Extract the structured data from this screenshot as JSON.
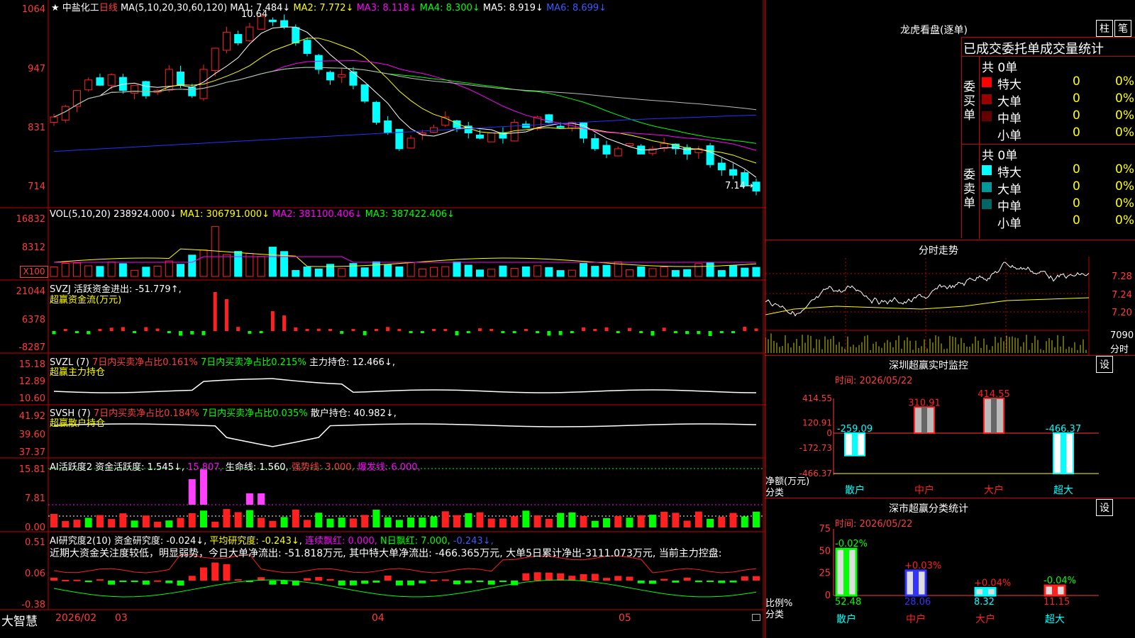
{
  "colors": {
    "up": "#ff2020",
    "down": "#00ffff",
    "grid": "#c00000",
    "axis": "#ff3b3b",
    "green": "#00ff00",
    "magenta": "#ff00ff",
    "yellow": "#ffff00",
    "blue": "#0000ff"
  },
  "header": {
    "star": "★",
    "stock": "中盐化工",
    "period": "日线",
    "ma_title": "MA(5,10,20,30,60,120)",
    "ma1": "MA1: 7.484↓",
    "ma2": "MA2: 7.772↓",
    "ma3": "MA3: 8.118↓",
    "ma4": "MA4: 8.300↓",
    "ma5": "MA5: 8.919↓",
    "ma6": "MA6: 8.699↓",
    "high_mark": "10.64",
    "low_mark": "7.14→"
  },
  "main_axis": [
    "1064",
    "947",
    "831",
    "714"
  ],
  "vol": {
    "title": "VOL(5,10,20)",
    "value": "238924.000↓",
    "ma1": "MA1: 306791.000↓",
    "ma2": "MA2: 381100.406↓",
    "ma3": "MA3: 387422.406↓",
    "axis": [
      "16832",
      "8312"
    ],
    "unit": "X100"
  },
  "svzj": {
    "title": "SVZJ  活跃资金进出: -51.779↑,",
    "sub": "超赢资金流(万元)",
    "axis": [
      "21044",
      "6378",
      "-8287"
    ]
  },
  "svzl": {
    "t1": "SVZL (7)",
    "t2": "7日内买卖净占比0.161%",
    "t3": "7日内买卖净占比0.215%",
    "t4": "主力持仓: 12.466↓,",
    "sub": "超赢主力持仓",
    "axis": [
      "15.18",
      "12.89",
      "10.60"
    ]
  },
  "svsh": {
    "t1": "SVSH (7)",
    "t2": "7日内买卖净占比0.184%",
    "t3": "7日内买卖净占比0.035%",
    "t4": "散户持仓: 40.982↓,",
    "sub": "超赢散户持仓",
    "axis": [
      "41.92",
      "39.60",
      "37.37"
    ]
  },
  "ai1": {
    "t1": "AI活跃度2",
    "t2": "资金活跃度: 1.545↓,",
    "t3": "15.807,",
    "t4": "生命线: 1.560,",
    "t5": "强势线: 3.000,",
    "t6": "爆发线: 6.000,",
    "axis": [
      "15.81",
      "7.81",
      "0.00"
    ]
  },
  "ai2": {
    "t1": "AI研究度2(10)",
    "t2": "资金研究度: -0.024↓,",
    "t3": "平均研究度: -0.243↓,",
    "t4": "连续飘红: 0.000,",
    "t5": "N日飘红: 7.000,",
    "t6": "-0.243↓,",
    "note": "近期大资金关注度较低，明显弱势，今日大单净流出: -51.818万元, 其中特大单净流出: -466.365万元, 大单5日累计净出-3111.073万元, 当前主力控盘:",
    "axis": [
      "0.51",
      "0.06",
      "-0.38"
    ]
  },
  "footer": {
    "brand": "大智慧",
    "dates": [
      "2026/02",
      "03",
      "04",
      "05"
    ]
  },
  "lhb": {
    "title": "龙虎看盘(逐单)",
    "btn1": "柱",
    "btn2": "笔",
    "subtitle": "已成交委托单成交量统计",
    "buy_label": "委买单",
    "sell_label": "委卖单",
    "buy_total": "共 0单",
    "sell_total": "共 0单",
    "buy_rows": [
      {
        "label": "特大",
        "n": "0",
        "pct": "0%",
        "color": "#ff0000"
      },
      {
        "label": "大单",
        "n": "0",
        "pct": "0%",
        "color": "#990000"
      },
      {
        "label": "中单",
        "n": "0",
        "pct": "0%",
        "color": "#660000"
      },
      {
        "label": "小单",
        "n": "0",
        "pct": "0%",
        "color": ""
      }
    ],
    "sell_rows": [
      {
        "label": "特大",
        "n": "0",
        "pct": "0%",
        "color": "#00ffff"
      },
      {
        "label": "大单",
        "n": "0",
        "pct": "0%",
        "color": "#009999"
      },
      {
        "label": "中单",
        "n": "0",
        "pct": "0%",
        "color": "#006666"
      },
      {
        "label": "小单",
        "n": "0",
        "pct": "0%",
        "color": ""
      }
    ]
  },
  "fenshi": {
    "title": "分时走势",
    "axis": [
      "7.28",
      "7.24",
      "7.20"
    ],
    "vol_label": "7090",
    "vol_unit": "分时"
  },
  "sz_monitor": {
    "title": "深圳超赢实时监控",
    "btn": "设",
    "time": "时间: 2026/05/22",
    "axis": [
      "414.55",
      "120.91",
      "0",
      "-172.73",
      "-466.37"
    ],
    "ylabel1": "净额(万元)",
    "ylabel2": "分类",
    "categories": [
      "散户",
      "中户",
      "大户",
      "超大"
    ],
    "values": [
      -259.09,
      310.91,
      414.55,
      -466.37
    ],
    "labels": [
      "-259.09",
      "310.91",
      "414.55",
      "-466.37"
    ]
  },
  "sz_class": {
    "title": "深市超赢分类统计",
    "btn": "设",
    "time": "时间: 2026/05/22",
    "axis": [
      "75",
      "50",
      "25",
      "0"
    ],
    "ylabel1": "比例%",
    "ylabel2": "分类",
    "categories": [
      "散户",
      "中户",
      "大户",
      "超大"
    ],
    "values": [
      52.48,
      28.06,
      8.32,
      11.15
    ],
    "value_labels": [
      "52.48",
      "28.06",
      "8.32",
      "11.15"
    ],
    "changes": [
      "-0.02%",
      "+0.03%",
      "+0.04%",
      "-0.04%"
    ],
    "colors": [
      "#00ff00",
      "#3333ff",
      "#00ffff",
      "#ff2020"
    ]
  }
}
